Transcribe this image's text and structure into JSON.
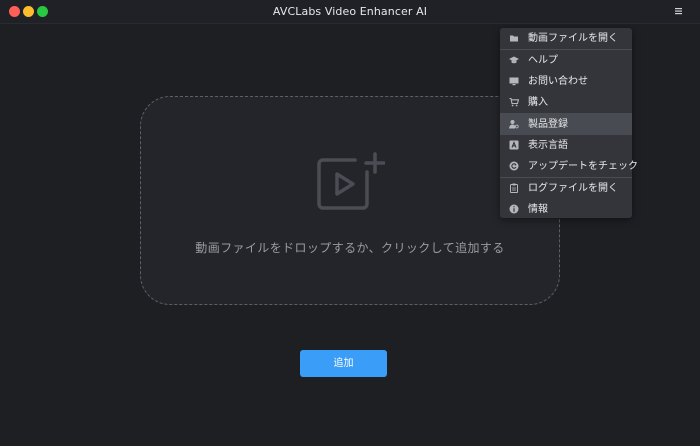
{
  "window": {
    "title": "AVCLabs Video Enhancer AI",
    "menu_icon": "hamburger-icon"
  },
  "dropzone": {
    "icon": "video-add-icon",
    "text": "動画ファイルをドロップするか、クリックして追加する"
  },
  "add_button": {
    "label": "追加"
  },
  "menu": {
    "items": [
      {
        "label": "動画ファイルを開く",
        "icon": "folder-icon"
      },
      {
        "label": "ヘルプ",
        "icon": "graduation-cap-icon"
      },
      {
        "label": "お問い合わせ",
        "icon": "monitor-icon"
      },
      {
        "label": "購入",
        "icon": "cart-icon"
      },
      {
        "label": "製品登録",
        "icon": "user-key-icon"
      },
      {
        "label": "表示言語",
        "icon": "language-icon"
      },
      {
        "label": "アップデートをチェック",
        "icon": "refresh-icon"
      },
      {
        "label": "ログファイルを開く",
        "icon": "clipboard-icon"
      },
      {
        "label": "情報",
        "icon": "info-icon"
      }
    ],
    "hovered_index": 4
  },
  "colors": {
    "background": "#1e1f23",
    "accent": "#3a9df7",
    "menu_background": "#33353b",
    "menu_hover": "#484b52"
  }
}
